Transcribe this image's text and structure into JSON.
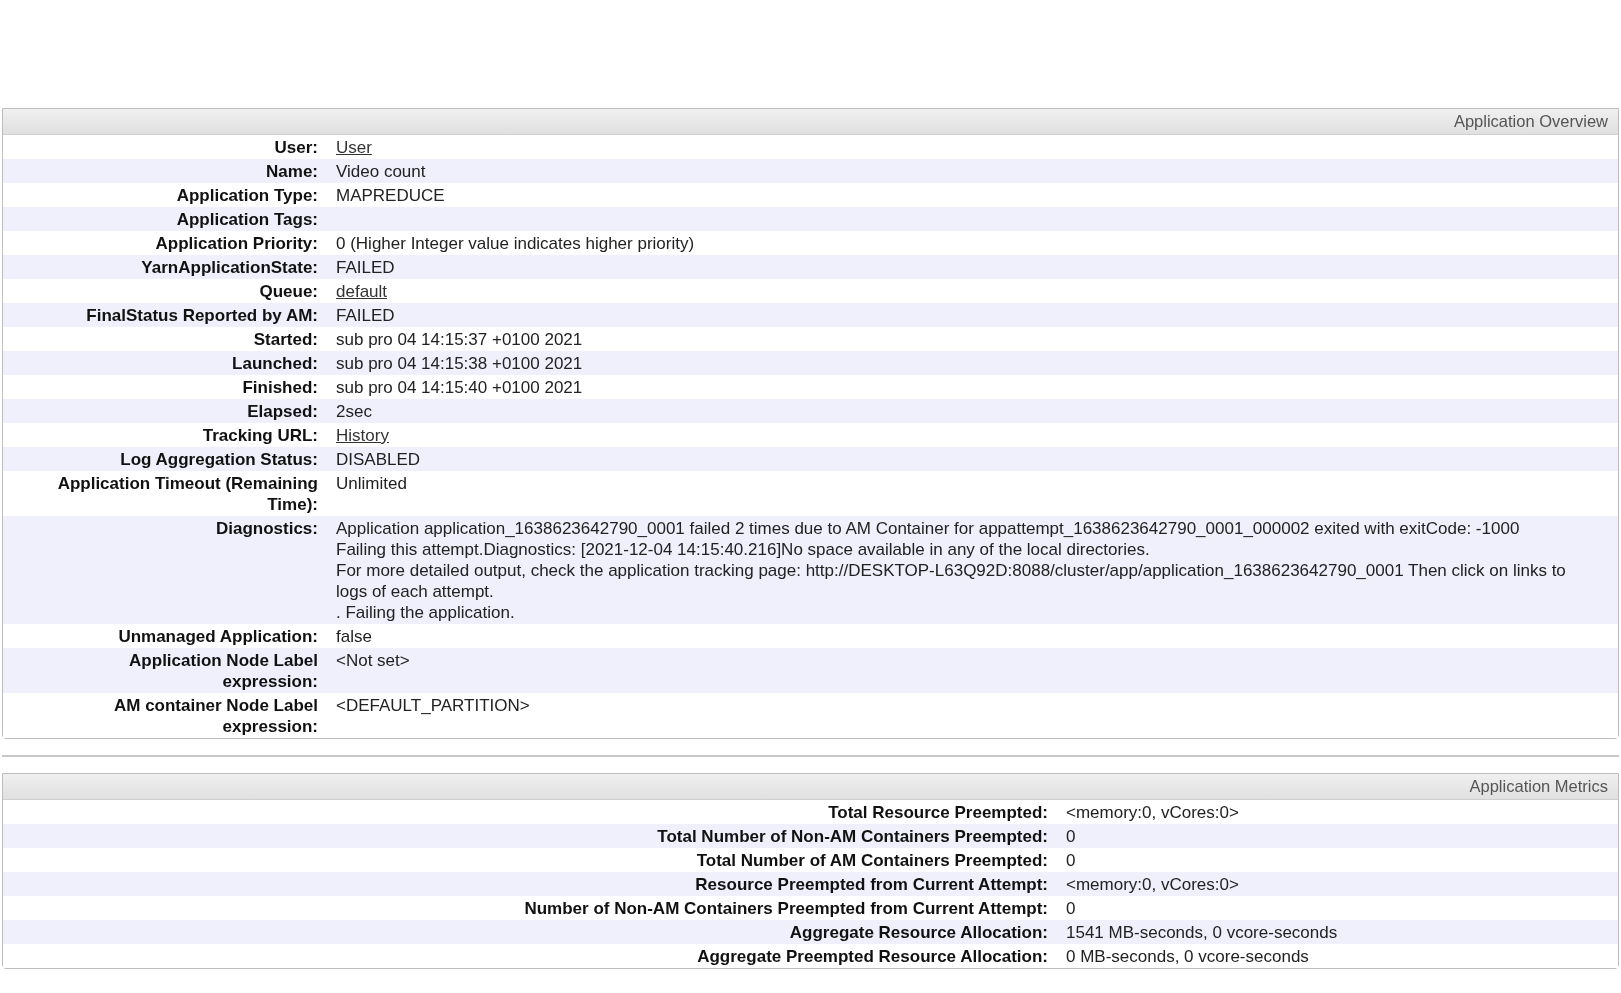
{
  "sections": [
    {
      "title": "Application Overview",
      "rows": [
        {
          "label": "User:",
          "value": "User",
          "kind": "link"
        },
        {
          "label": "Name:",
          "value": "Video count",
          "kind": "text"
        },
        {
          "label": "Application Type:",
          "value": "MAPREDUCE",
          "kind": "text"
        },
        {
          "label": "Application Tags:",
          "kind": "empty"
        },
        {
          "label": "Application Priority:",
          "value": "0 (Higher Integer value indicates higher priority)",
          "kind": "text"
        },
        {
          "label": "YarnApplicationState:",
          "value": "FAILED",
          "kind": "text"
        },
        {
          "label": "Queue:",
          "value": "default",
          "kind": "link"
        },
        {
          "label": "FinalStatus Reported by AM:",
          "value": "FAILED",
          "kind": "text"
        },
        {
          "label": "Started:",
          "value": "sub pro 04 14:15:37 +0100 2021",
          "kind": "text"
        },
        {
          "label": "Launched:",
          "value": "sub pro 04 14:15:38 +0100 2021",
          "kind": "text"
        },
        {
          "label": "Finished:",
          "value": "sub pro 04 14:15:40 +0100 2021",
          "kind": "text"
        },
        {
          "label": "Elapsed:",
          "value": "2sec",
          "kind": "text"
        },
        {
          "label": "Tracking URL:",
          "value": "History",
          "kind": "link"
        },
        {
          "label": "Log Aggregation Status:",
          "value": "DISABLED",
          "kind": "text"
        },
        {
          "label": "Application Timeout (Remaining Time):",
          "value": "Unlimited",
          "kind": "text"
        },
        {
          "label": "Diagnostics:",
          "value": "Application application_1638623642790_0001 failed 2 times due to AM Container for appattempt_1638623642790_0001_000002 exited with exitCode: -1000\nFailing this attempt.Diagnostics: [2021-12-04 14:15:40.216]No space available in any of the local directories.\nFor more detailed output, check the application tracking page: http://DESKTOP-L63Q92D:8088/cluster/app/application_1638623642790_0001 Then click on links to logs of each attempt.\n. Failing the application.",
          "kind": "text"
        },
        {
          "label": "Unmanaged Application:",
          "value": "false",
          "kind": "text"
        },
        {
          "label": "Application Node Label expression:",
          "value": "<Not set>",
          "kind": "text"
        },
        {
          "label": "AM container Node Label expression:",
          "value": "<DEFAULT_PARTITION>",
          "kind": "text"
        }
      ]
    },
    {
      "title": "Application Metrics",
      "rows": [
        {
          "label": "Total Resource Preempted:",
          "value": "<memory:0, vCores:0>",
          "kind": "text"
        },
        {
          "label": "Total Number of Non-AM Containers Preempted:",
          "value": "0",
          "kind": "text"
        },
        {
          "label": "Total Number of AM Containers Preempted:",
          "value": "0",
          "kind": "text"
        },
        {
          "label": "Resource Preempted from Current Attempt:",
          "value": "<memory:0, vCores:0>",
          "kind": "text"
        },
        {
          "label": "Number of Non-AM Containers Preempted from Current Attempt:",
          "value": "0",
          "kind": "text"
        },
        {
          "label": "Aggregate Resource Allocation:",
          "value": "1541 MB-seconds, 0 vcore-seconds",
          "kind": "text"
        },
        {
          "label": "Aggregate Preempted Resource Allocation:",
          "value": "0 MB-seconds, 0 vcore-seconds",
          "kind": "text"
        }
      ]
    }
  ]
}
